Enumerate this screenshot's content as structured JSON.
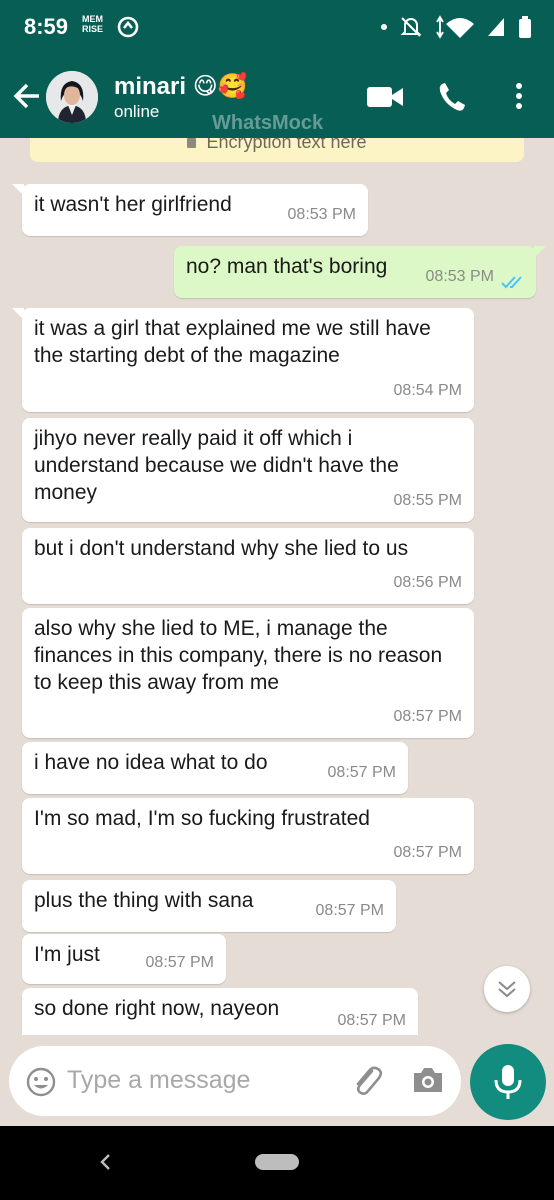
{
  "status_bar": {
    "time": "8:59",
    "memrise_line1": "MEM",
    "memrise_line2": "RISE"
  },
  "header": {
    "contact_name": "minari",
    "name_emojis": "😋🥰",
    "status": "online",
    "watermark": "WhatsMock"
  },
  "chat": {
    "encryption_text": "Encryption text here",
    "messages": [
      {
        "text": "it wasn't her girlfriend",
        "time": "08:53 PM",
        "dir": "in"
      },
      {
        "text": "no? man that's boring",
        "time": "08:53 PM",
        "dir": "out"
      },
      {
        "text": "it was a girl that explained me we still have the starting debt of the magazine",
        "time": "08:54 PM",
        "dir": "in"
      },
      {
        "text": "jihyo never really paid it off which i understand because we didn't have the money",
        "time": "08:55 PM",
        "dir": "in"
      },
      {
        "text": "but i don't understand why she lied to us",
        "time": "08:56 PM",
        "dir": "in"
      },
      {
        "text": "also why she lied to ME, i manage the finances in this company, there is no reason to keep this away from me",
        "time": "08:57 PM",
        "dir": "in"
      },
      {
        "text": "i have no idea what to do",
        "time": "08:57 PM",
        "dir": "in"
      },
      {
        "text": "I'm so mad, I'm so fucking frustrated",
        "time": "08:57 PM",
        "dir": "in"
      },
      {
        "text": "plus the thing with sana",
        "time": "08:57 PM",
        "dir": "in"
      },
      {
        "text": "I'm just",
        "time": "08:57 PM",
        "dir": "in"
      },
      {
        "text": "so done right now, nayeon",
        "time": "08:57 PM",
        "dir": "in"
      }
    ]
  },
  "composer": {
    "placeholder": "Type a message"
  },
  "colors": {
    "header": "#075e54",
    "chat_bg": "#e5ddd5",
    "outgoing": "#dcf8c6",
    "incoming": "#ffffff",
    "mic": "#128c7e",
    "read_ticks": "#4fc3f7"
  }
}
